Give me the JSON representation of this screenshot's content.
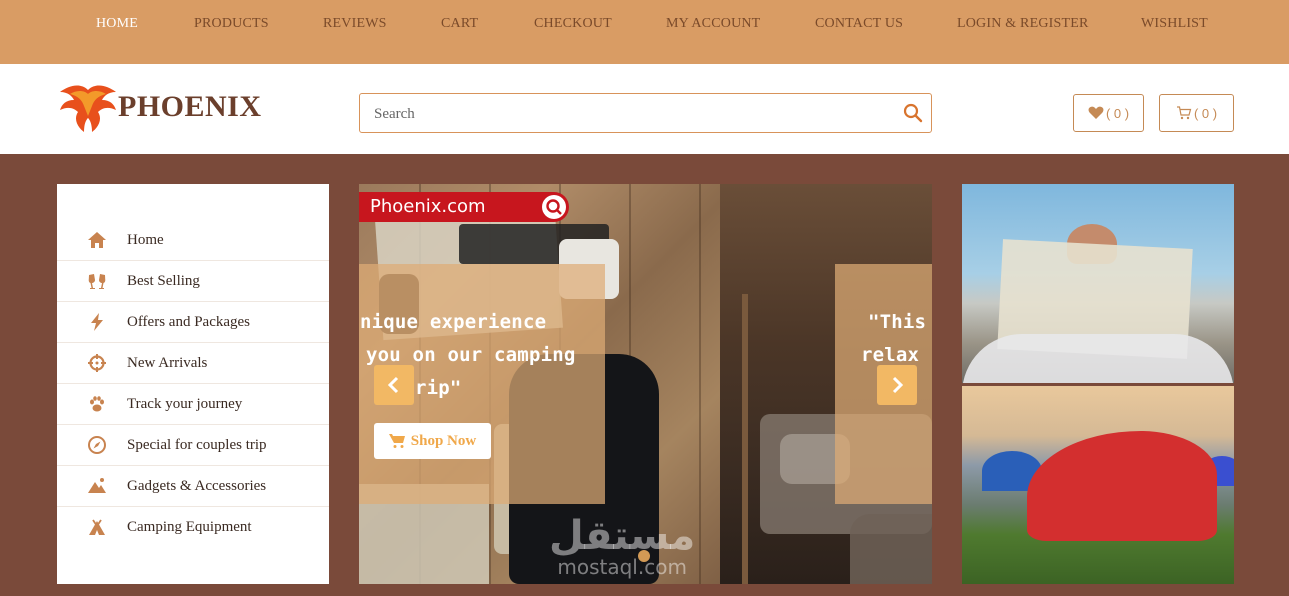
{
  "topnav": {
    "items": [
      {
        "label": "HOME",
        "active": true
      },
      {
        "label": "PRODUCTS"
      },
      {
        "label": "REVIEWS"
      },
      {
        "label": "CART"
      },
      {
        "label": "CHECKOUT"
      },
      {
        "label": "MY ACCOUNT"
      },
      {
        "label": "CONTACT US"
      },
      {
        "label": "LOGIN & REGISTER"
      },
      {
        "label": "WISHLIST"
      }
    ]
  },
  "header": {
    "logo_text": "PHOENIX",
    "search_placeholder": "Search",
    "wishlist_count": "( 0 )",
    "cart_count": "( 0 )"
  },
  "sidebar": {
    "items": [
      {
        "label": "Home",
        "icon": "home-icon"
      },
      {
        "label": "Best Selling",
        "icon": "cheers-icon"
      },
      {
        "label": "Offers and Packages",
        "icon": "bolt-icon"
      },
      {
        "label": "New Arrivals",
        "icon": "crosshair-icon"
      },
      {
        "label": "Track your journey",
        "icon": "paw-icon"
      },
      {
        "label": "Special for couples trip",
        "icon": "compass-icon"
      },
      {
        "label": "Gadgets & Accessories",
        "icon": "mountain-icon"
      },
      {
        "label": "Camping Equipment",
        "icon": "campground-icon"
      }
    ]
  },
  "slider": {
    "brand": "Phoenix.com",
    "caption1_line1": "nique experience",
    "caption1_line2": "you on our camping",
    "caption1_line3": "rip\"",
    "caption2_line1": "\"This",
    "caption2_line2": "relax",
    "shop_now": "Shop Now",
    "watermark_ar": "مستقل",
    "watermark_en": "mostaql.com"
  },
  "colors": {
    "nav_bg": "#d99c64",
    "page_bg": "#7a4a3a",
    "accent": "#c8834f",
    "arrow_bg": "#f2b864"
  }
}
